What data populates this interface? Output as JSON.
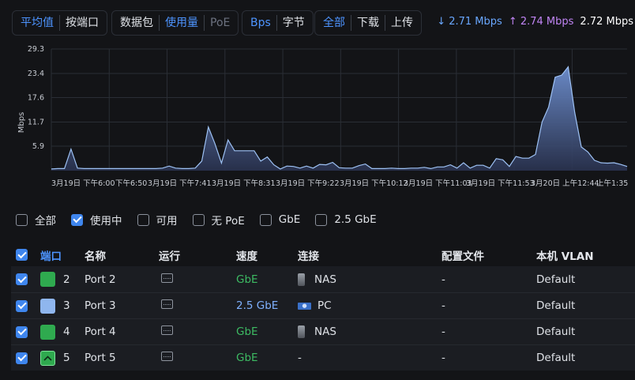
{
  "toolbar": {
    "mode_group": {
      "options": [
        "平均值",
        "按端口"
      ],
      "active": 0
    },
    "metric_group": {
      "options": [
        "数据包",
        "使用量",
        "PoE"
      ],
      "active": 1
    },
    "unit_group": {
      "options": [
        "Bps",
        "字节"
      ],
      "active": 0
    },
    "direction_group": {
      "options": [
        "全部",
        "下载",
        "上传"
      ],
      "active": 0
    }
  },
  "stats": {
    "download": "↓ 2.71 Mbps",
    "upload": "↑ 2.74 Mbps",
    "total": "2.72 Mbps",
    "download_color": "#69a7ff",
    "upload_color": "#c185f5"
  },
  "chart_data": {
    "type": "area",
    "ylabel": "Mbps",
    "yticks": [
      "5.9",
      "11.7",
      "17.6",
      "23.4",
      "29.3"
    ],
    "ylim": [
      0,
      29.3
    ],
    "grid": true,
    "fill_color": "#5b79b5",
    "line_color": "#9ec2f5",
    "x_tick_labels": [
      "3月19日 下午6:00",
      "下午6:50",
      "3月19日 下午7:41",
      "3月19日 下午8:31",
      "3月19日 下午9:22",
      "3月19日 下午10:12",
      "3月19日 下午11:03",
      "3月19日 下午11:53",
      "3月20日 上午12:44",
      "上午1:35"
    ],
    "values": [
      0.4,
      0.5,
      0.5,
      5.2,
      0.6,
      0.5,
      0.5,
      0.5,
      0.5,
      0.5,
      0.5,
      0.5,
      0.5,
      0.5,
      0.5,
      0.5,
      0.5,
      0.6,
      1.1,
      0.6,
      0.5,
      0.5,
      0.6,
      2.3,
      10.5,
      6.5,
      1.8,
      7.4,
      4.8,
      4.8,
      4.8,
      4.8,
      2.3,
      3.3,
      1.4,
      0.4,
      1.1,
      1.0,
      0.6,
      1.1,
      0.6,
      1.5,
      1.4,
      2.0,
      0.7,
      0.6,
      0.6,
      1.2,
      1.6,
      0.5,
      0.5,
      0.5,
      0.6,
      0.5,
      0.5,
      0.6,
      0.6,
      0.8,
      0.5,
      0.9,
      0.9,
      1.4,
      0.6,
      1.9,
      0.6,
      1.3,
      1.3,
      0.6,
      2.9,
      2.6,
      1.0,
      3.4,
      3.0,
      3.0,
      3.9,
      11.7,
      15.3,
      22.5,
      23.0,
      25.0,
      14.0,
      5.7,
      4.5,
      2.5,
      1.9,
      1.8,
      1.9,
      1.5,
      1.0
    ]
  },
  "filters": [
    {
      "label": "全部",
      "checked": false
    },
    {
      "label": "使用中",
      "checked": true
    },
    {
      "label": "可用",
      "checked": false
    },
    {
      "label": "无 PoE",
      "checked": false
    },
    {
      "label": "GbE",
      "checked": false
    },
    {
      "label": "2.5 GbE",
      "checked": false
    }
  ],
  "table": {
    "headers": {
      "port": "端口",
      "name": "名称",
      "run": "运行",
      "speed": "速度",
      "link": "连接",
      "profile": "配置文件",
      "vlan": "本机 VLAN"
    },
    "rows": [
      {
        "port": "2",
        "name": "Port 2",
        "speed": "GbE",
        "speed_kind": "gbe",
        "link": "NAS",
        "link_icon": "nas-icon",
        "profile": "-",
        "vlan": "Default",
        "swatch_color": "#2faa4f",
        "swatch_icon": ""
      },
      {
        "port": "3",
        "name": "Port 3",
        "speed": "2.5 GbE",
        "speed_kind": "25",
        "link": "PC",
        "link_icon": "pc-icon",
        "profile": "-",
        "vlan": "Default",
        "swatch_color": "#8fb6ee",
        "swatch_icon": ""
      },
      {
        "port": "4",
        "name": "Port 4",
        "speed": "GbE",
        "speed_kind": "gbe",
        "link": "NAS",
        "link_icon": "nas-icon",
        "profile": "-",
        "vlan": "Default",
        "swatch_color": "#2faa4f",
        "swatch_icon": ""
      },
      {
        "port": "5",
        "name": "Port 5",
        "speed": "GbE",
        "speed_kind": "gbe",
        "link": "-",
        "link_icon": "",
        "profile": "-",
        "vlan": "Default",
        "swatch_color": "#2faa4f",
        "swatch_icon": "uplink-chevron-icon"
      }
    ]
  }
}
